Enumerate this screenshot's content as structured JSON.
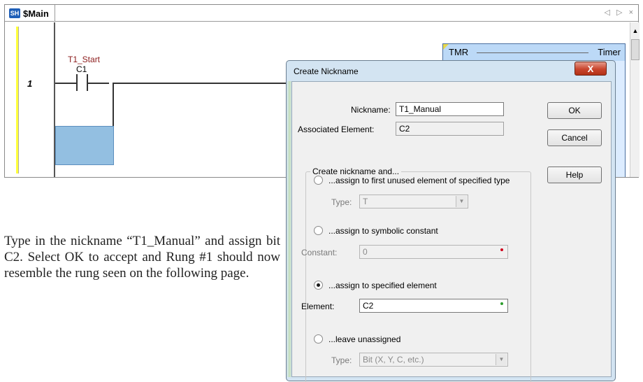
{
  "editor": {
    "tab_icon": "SH",
    "tab_title": "$Main",
    "tab_controls": "◁ ▷ ×",
    "rung_number": "1",
    "contact_nickname": "T1_Start",
    "contact_address": "C1",
    "timer_instruction": "TMR",
    "timer_title": "Timer",
    "scroll_up_glyph": "▲"
  },
  "description": "Type in the nickname “T1_Manual” and assign bit C2. Select OK to accept and Rung #1 should now resemble the rung seen on the following page.",
  "dialog": {
    "title": "Create Nickname",
    "close_glyph": "X",
    "nickname_label": "Nickname:",
    "nickname_value": "T1_Manual",
    "associated_label": "Associated Element:",
    "associated_value": "C2",
    "ok_label": "OK",
    "cancel_label": "Cancel",
    "help_label": "Help",
    "group_title": "Create nickname and...",
    "options": {
      "first_unused": "...assign to first unused element of specified type",
      "first_unused_type_label": "Type:",
      "first_unused_type_value": "T",
      "symbolic": "...assign to symbolic constant",
      "constant_label": "Constant:",
      "constant_value": "0",
      "specified": "...assign to specified element",
      "element_label": "Element:",
      "element_value": "C2",
      "unassigned": "...leave unassigned",
      "unassigned_type_label": "Type:",
      "unassigned_type_value": "Bit (X, Y, C, etc.)"
    },
    "selected_option": "specified",
    "colors": {
      "constant_dot": "#d0021b",
      "element_dot": "#2e9e2e",
      "close_button": "#c9452d"
    }
  }
}
